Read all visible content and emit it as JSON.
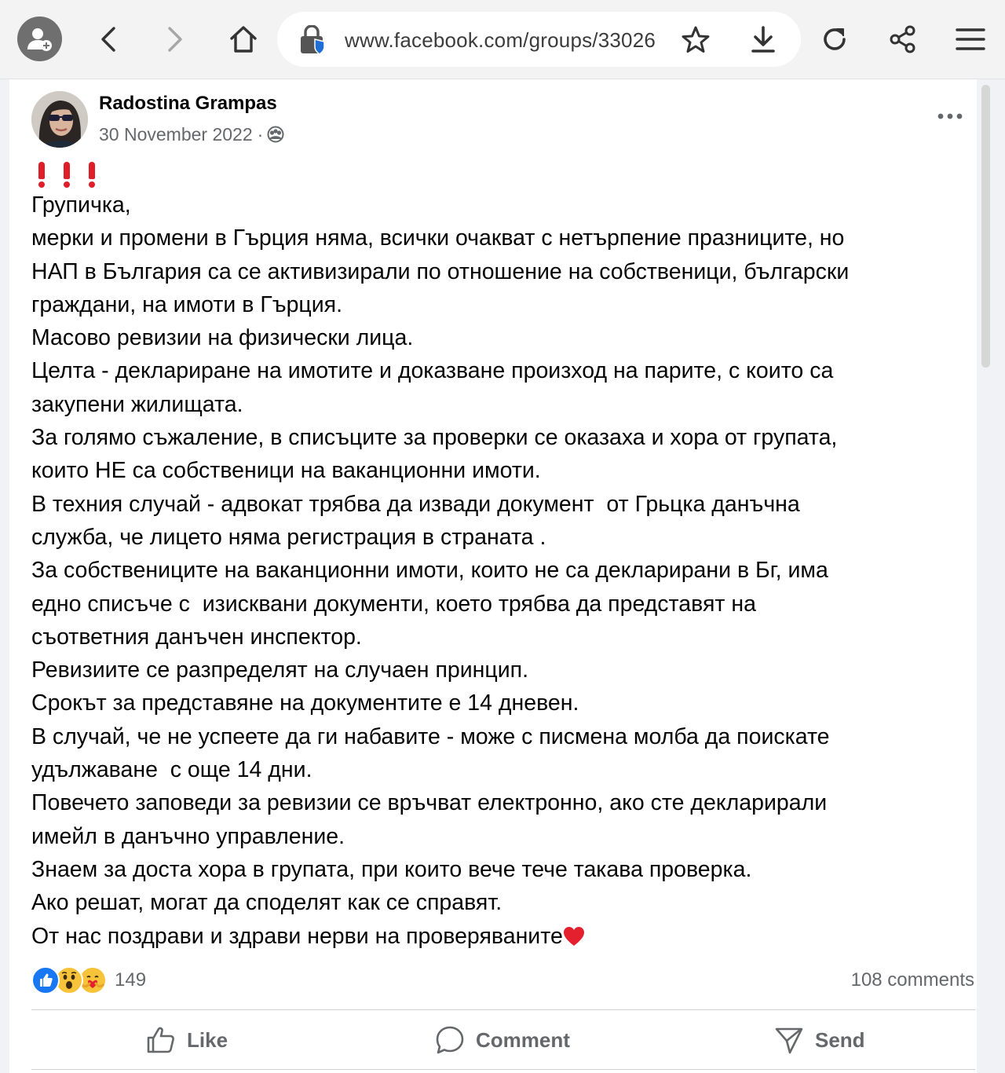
{
  "browser": {
    "url": "www.facebook.com/groups/33026"
  },
  "post": {
    "author": "Radostina Grampas",
    "date": "30 November 2022",
    "separator": "·",
    "body_lines": [
      "Групичка,",
      "мерки и промени в Гърция няма, всички очакват с нетърпение празниците, но",
      "НАП в България са се активизирали по отношение на собственици, български",
      "граждани, на имоти в Гърция.",
      "Масово ревизии на физически лица.",
      "Целта - деклариране на имотите и доказване произход на парите, с които са",
      "закупени жилищата.",
      "За голямо съжаление, в списъците за проверки се оказаха и хора от групата,",
      "които НЕ са собственици на ваканционни имоти.",
      "В техния случай - адвокат трябва да извади документ  от Грьцка данъчна",
      "служба, че лицето няма регистрация в страната .",
      "За собствениците на ваканционни имоти, които не са декларирани в Бг, има",
      "едно списъче с  изисквани документи, което трябва да представят на",
      "съответния данъчен инспектор.",
      "Ревизиите се разпределят на случаен принцип.",
      "Срокът за представяне на документите е 14 дневен.",
      "В случай, че не успеете да ги набавите - може с писмена молба да поискате",
      "удължаване  с още 14 дни.",
      "Повечето заповеди за ревизии се връчват електронно, ако сте декларирали",
      "имейл в данъчно управление.",
      "Знаем за доста хора в групата, при които вече тече такава проверка.",
      "Ако решат, могат да споделят как се справят.",
      "От нас поздрави и здрави нерви на проверяваните"
    ],
    "reaction_count": "149",
    "comments_count": "108 comments",
    "actions": {
      "like": "Like",
      "comment": "Comment",
      "send": "Send"
    }
  },
  "colors": {
    "link_blue": "#1877f2",
    "exclaim_red": "#dd1f2a",
    "secondary_text": "#65676b"
  },
  "icons": {
    "toolbar": [
      "profile-icon",
      "back-icon",
      "forward-icon",
      "home-icon",
      "lock-icon",
      "star-icon",
      "download-icon",
      "reload-icon",
      "share-icon",
      "menu-icon"
    ],
    "post": [
      "more-icon",
      "privacy-icon",
      "heart-emoji",
      "like-reaction-icon",
      "wow-reaction-icon",
      "care-reaction-icon",
      "like-icon",
      "comment-icon",
      "send-icon"
    ]
  }
}
